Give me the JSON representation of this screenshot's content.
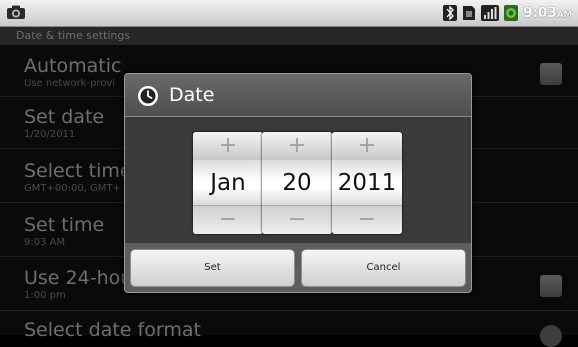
{
  "status_bar": {
    "time": "9:03",
    "ampm": "AM",
    "icons": [
      "camera-icon",
      "bluetooth-icon",
      "sim-icon",
      "signal-icon",
      "battery-icon"
    ]
  },
  "settings": {
    "title": "Date & time settings",
    "items": [
      {
        "title": "Automatic",
        "subtitle": "Use network-provi"
      },
      {
        "title": "Set date",
        "subtitle": "1/20/2011"
      },
      {
        "title": "Select time z",
        "subtitle": "GMT+00:00, GMT+"
      },
      {
        "title": "Set time",
        "subtitle": "9:03 AM"
      },
      {
        "title": "Use 24-hou",
        "subtitle": "1:00 pm"
      },
      {
        "title": "Select date format",
        "subtitle": ""
      }
    ]
  },
  "dialog": {
    "title": "Date",
    "month": "Jan",
    "day": "20",
    "year": "2011",
    "plus": "+",
    "minus": "−",
    "set_label": "Set",
    "cancel_label": "Cancel"
  }
}
